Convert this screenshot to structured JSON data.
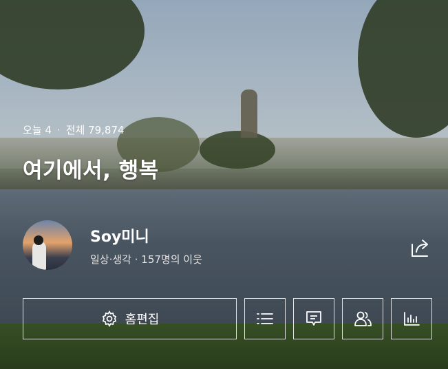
{
  "blog": {
    "today_label": "오늘 4",
    "total_label": "전체 79,874",
    "title": "여기에서, 행복"
  },
  "profile": {
    "name": "Soy미니",
    "meta": "일상·생각 · 157명의 이웃"
  },
  "actions": {
    "edit_label": "홈편집"
  }
}
